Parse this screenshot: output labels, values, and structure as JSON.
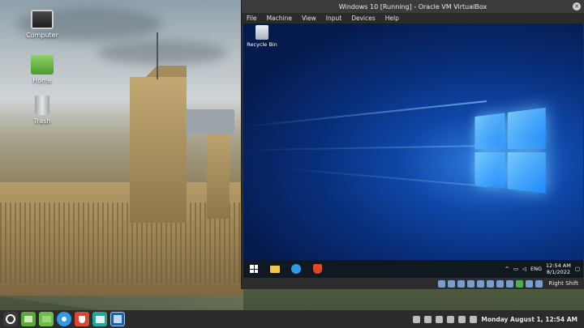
{
  "desktop": {
    "icons": [
      {
        "label": "Computer",
        "icon": "computer-icon"
      },
      {
        "label": "Home",
        "icon": "home-folder-icon"
      },
      {
        "label": "Trash",
        "icon": "trash-icon"
      }
    ]
  },
  "vm_window": {
    "title": "Windows 10 [Running] - Oracle VM VirtualBox",
    "menu": [
      "File",
      "Machine",
      "View",
      "Input",
      "Devices",
      "Help"
    ],
    "host_key": "Right Shift"
  },
  "guest": {
    "recycle_label": "Recycle Bin",
    "tray_lang": "ENG",
    "clock_time": "12:54 AM",
    "clock_date": "8/1/2022"
  },
  "host_taskbar": {
    "clock": "Monday August  1, 12:54 AM"
  },
  "colors": {
    "host_taskbar": "#2b2b2b",
    "guest_taskbar": "#101820",
    "win_blue": "#1f8fff"
  }
}
